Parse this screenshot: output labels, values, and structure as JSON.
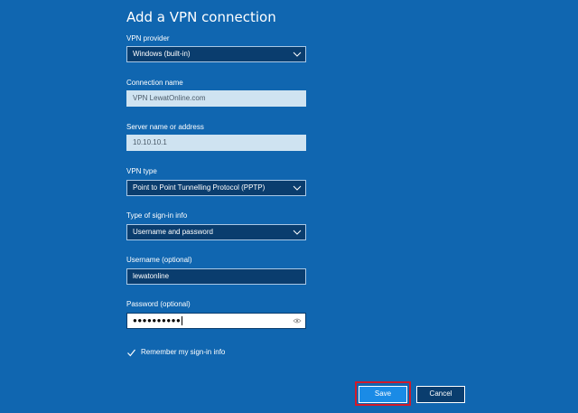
{
  "title": "Add a VPN connection",
  "vpn_provider": {
    "label": "VPN provider",
    "value": "Windows (built-in)",
    "icon": "chevron-down-icon"
  },
  "connection_name": {
    "label": "Connection name",
    "value": "VPN LewatOnline.com"
  },
  "server": {
    "label": "Server name or address",
    "value": "10.10.10.1"
  },
  "vpn_type": {
    "label": "VPN type",
    "value": "Point to Point Tunnelling Protocol (PPTP)",
    "icon": "chevron-down-icon"
  },
  "signin_type": {
    "label": "Type of sign-in info",
    "value": "Username and password",
    "icon": "chevron-down-icon"
  },
  "username": {
    "label": "Username (optional)",
    "value": "lewatonline"
  },
  "password": {
    "label": "Password (optional)",
    "masked_value": "●●●●●●●●●●",
    "icon": "eye-icon"
  },
  "remember": {
    "label": "Remember my sign-in info",
    "checked": true
  },
  "buttons": {
    "save": "Save",
    "cancel": "Cancel"
  },
  "colors": {
    "background": "#1066b0",
    "input_dark": "#0a3d6e",
    "input_readonly": "#cfe3f1",
    "save_button": "#1a8be6",
    "highlight": "#d11a2a"
  }
}
